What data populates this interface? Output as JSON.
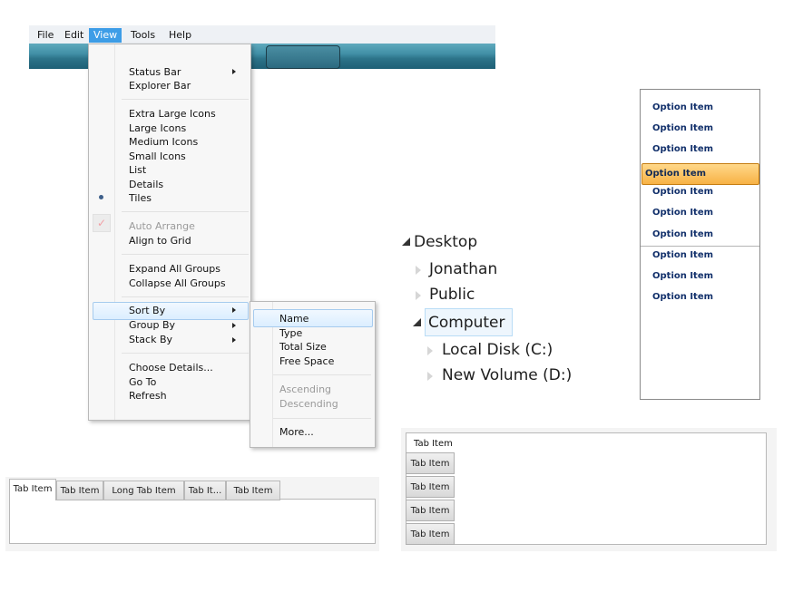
{
  "menubar": {
    "items": [
      "File",
      "Edit",
      "View",
      "Tools",
      "Help"
    ],
    "active": "View"
  },
  "view_menu": {
    "status_bar": "Status Bar",
    "explorer_bar": "Explorer Bar",
    "extra_large_icons": "Extra Large Icons",
    "large_icons": "Large Icons",
    "medium_icons": "Medium Icons",
    "small_icons": "Small Icons",
    "list": "List",
    "details": "Details",
    "tiles": "Tiles",
    "auto_arrange": "Auto Arrange",
    "align_to_grid": "Align to Grid",
    "expand_all_groups": "Expand All Groups",
    "collapse_all_groups": "Collapse All Groups",
    "sort_by": "Sort By",
    "group_by": "Group By",
    "stack_by": "Stack By",
    "choose_details": "Choose Details...",
    "go_to": "Go To",
    "refresh": "Refresh",
    "selected_view": "Tiles",
    "auto_arrange_checked": true
  },
  "sort_submenu": {
    "name": "Name",
    "type": "Type",
    "total_size": "Total Size",
    "free_space": "Free Space",
    "ascending": "Ascending",
    "descending": "Descending",
    "more": "More..."
  },
  "tree": {
    "desktop": "Desktop",
    "jonathan": "Jonathan",
    "public": "Public",
    "computer": "Computer",
    "local_disk": "Local Disk (C:)",
    "new_volume": "New Volume (D:)",
    "selected": "Computer"
  },
  "listbox": {
    "options": [
      "Option Item",
      "Option Item",
      "Option Item",
      "Option Item",
      "Option Item",
      "Option Item",
      "Option Item",
      "Option Item",
      "Option Item",
      "Option Item"
    ],
    "selected_index": 3
  },
  "horizontal_tabs": {
    "tabs": [
      "Tab Item",
      "Tab Item",
      "Long Tab Item",
      "Tab It...",
      "Tab Item"
    ],
    "active_index": 0
  },
  "vertical_tabs": {
    "header": "Tab Item",
    "tabs": [
      "Tab Item",
      "Tab Item",
      "Tab Item",
      "Tab Item"
    ]
  },
  "colors": {
    "menu_highlight": "#3d9de7",
    "toolbar": "#2c7389",
    "selected_option": "#f7b245",
    "option_text": "#12306b"
  }
}
